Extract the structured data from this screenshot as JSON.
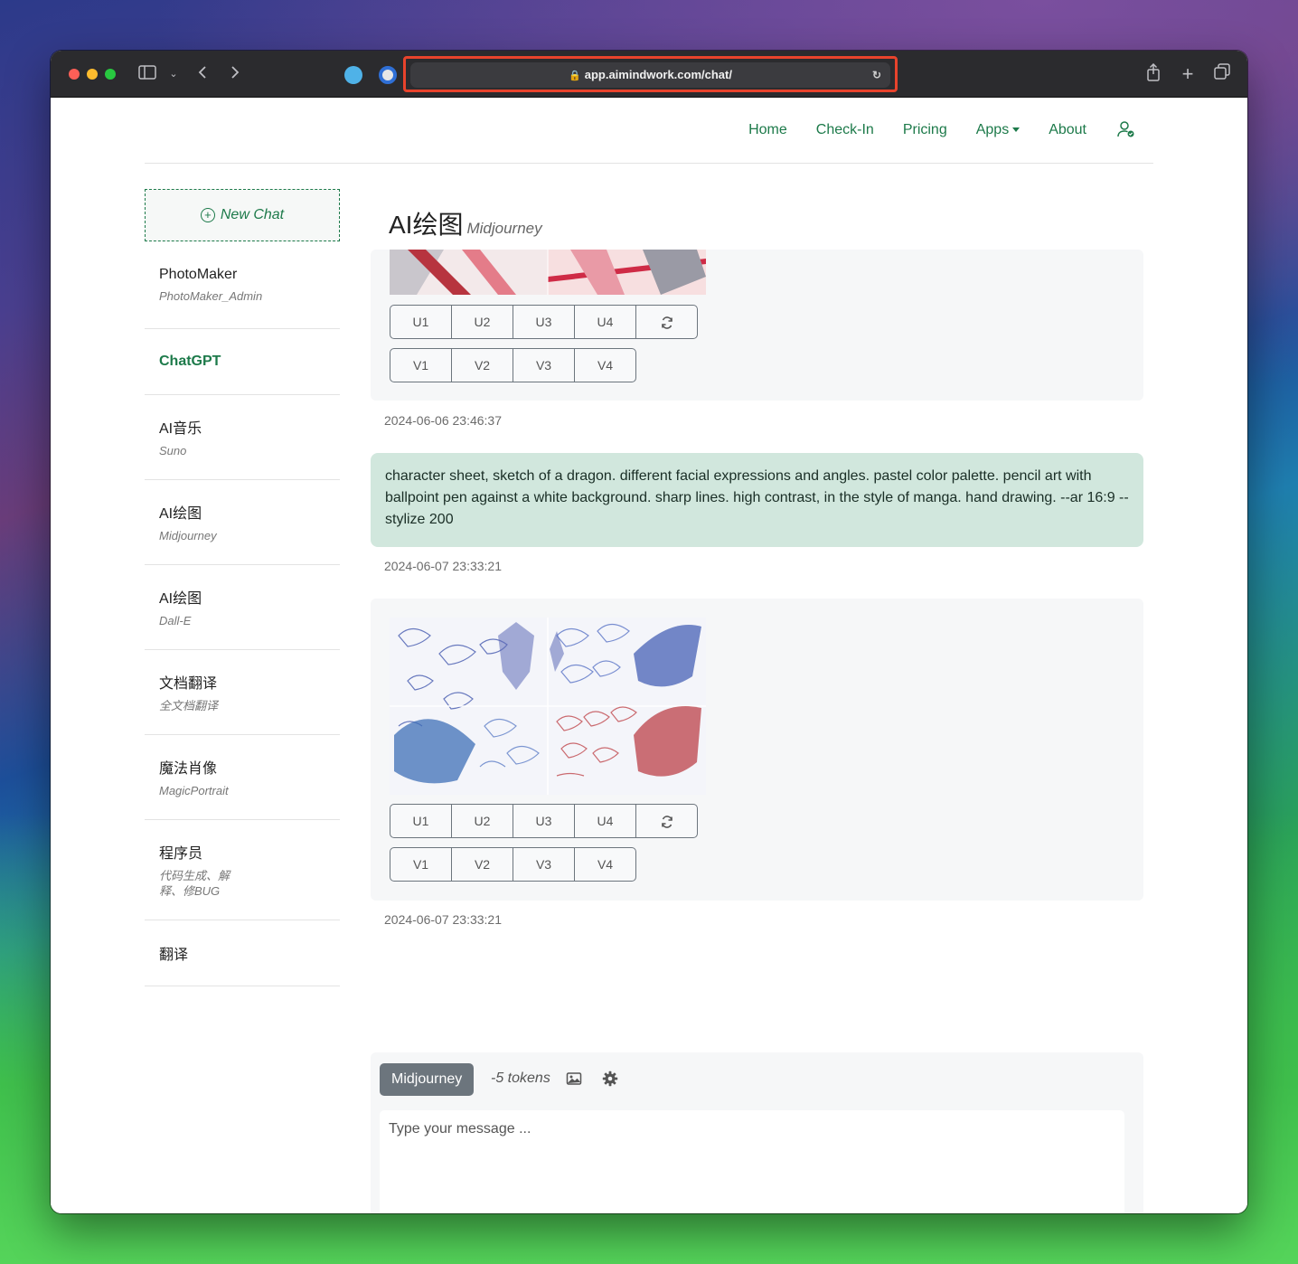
{
  "browser": {
    "url": "app.aimindwork.com/chat/"
  },
  "nav": {
    "links": [
      "Home",
      "Check-In",
      "Pricing",
      "Apps",
      "About"
    ]
  },
  "sidebar": {
    "new_chat": "New Chat",
    "items": [
      {
        "title": "PhotoMaker",
        "sub": "PhotoMaker_Admin"
      },
      {
        "title": "ChatGPT",
        "sub": ""
      },
      {
        "title": "AI音乐",
        "sub": "Suno"
      },
      {
        "title": "AI绘图",
        "sub": "Midjourney"
      },
      {
        "title": "AI绘图",
        "sub": "Dall-E"
      },
      {
        "title": "文档翻译",
        "sub": "全文档翻译"
      },
      {
        "title": "魔法肖像",
        "sub": "MagicPortrait"
      },
      {
        "title": "程序员",
        "sub": "代码生成、解释、修BUG"
      },
      {
        "title": "翻译",
        "sub": ""
      }
    ]
  },
  "main": {
    "title": "AI绘图",
    "subtitle": "Midjourney",
    "messages": [
      {
        "role": "bot",
        "timestamp": "2024-06-06 23:46:37",
        "upscale": [
          "U1",
          "U2",
          "U3",
          "U4"
        ],
        "variation": [
          "V1",
          "V2",
          "V3",
          "V4"
        ]
      },
      {
        "role": "user",
        "text": "character sheet, sketch of a dragon. different facial expressions and angles. pastel color palette. pencil art with ballpoint pen against a white background. sharp lines. high contrast, in the style of manga. hand drawing. --ar 16:9 --stylize 200",
        "timestamp": "2024-06-07 23:33:21"
      },
      {
        "role": "bot",
        "timestamp": "2024-06-07 23:33:21",
        "upscale": [
          "U1",
          "U2",
          "U3",
          "U4"
        ],
        "variation": [
          "V1",
          "V2",
          "V3",
          "V4"
        ]
      }
    ]
  },
  "composer": {
    "mode": "Midjourney",
    "tokens": "-5 tokens",
    "placeholder": "Type your message ..."
  },
  "colors": {
    "accent": "#1d7a4a",
    "user_bubble": "#d1e7dd",
    "bot_bubble": "#f6f7f8",
    "highlight": "#e8432c"
  }
}
